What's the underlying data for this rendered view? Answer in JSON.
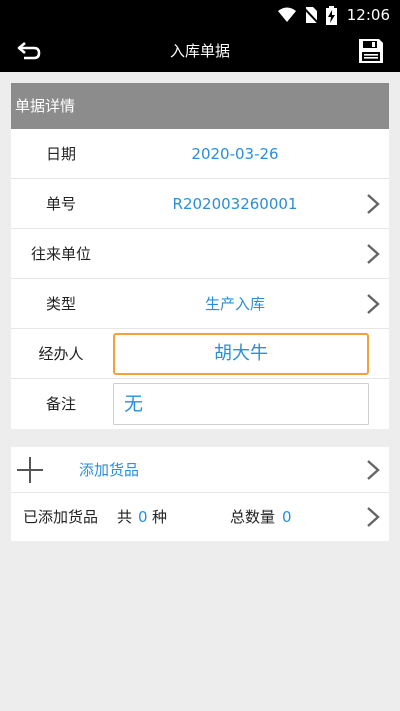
{
  "status_bar": {
    "time": "12:06"
  },
  "header": {
    "title": "入库单据"
  },
  "detail": {
    "section_title": "单据详情",
    "rows": [
      {
        "label": "日期",
        "value": "2020-03-26"
      },
      {
        "label": "单号",
        "value": "R202003260001"
      },
      {
        "label": "往来单位",
        "value": ""
      },
      {
        "label": "类型",
        "value": "生产入库"
      }
    ],
    "handler": {
      "label": "经办人",
      "value": "胡大牛"
    },
    "remark": {
      "label": "备注",
      "value": "无"
    }
  },
  "goods": {
    "add_label": "添加货品",
    "added_label": "已添加货品",
    "count_prefix": "共",
    "count": "0",
    "count_suffix": "种",
    "total_label": "总数量",
    "total": "0"
  },
  "colors": {
    "accent": "#2a8fd6",
    "focus": "#f2a23a",
    "header_gray": "#8c8c8c"
  }
}
